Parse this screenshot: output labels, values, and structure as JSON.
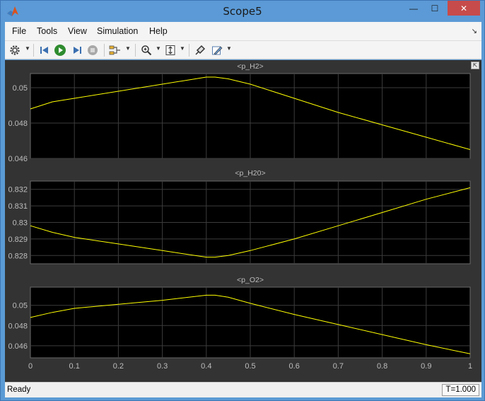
{
  "window": {
    "title": "Scope5",
    "minimize_glyph": "—",
    "maximize_glyph": "☐",
    "close_glyph": "✕"
  },
  "menu": {
    "items": [
      "File",
      "Tools",
      "View",
      "Simulation",
      "Help"
    ],
    "corner_glyph": "↘"
  },
  "toolbar": {
    "icons": [
      "gear-icon",
      "step-back-icon",
      "run-icon",
      "step-forward-icon",
      "stop-icon",
      "signal-selector-icon",
      "zoom-icon",
      "autoscale-icon",
      "highlight-icon",
      "style-icon"
    ]
  },
  "colors": {
    "plot_background": "#000000",
    "trace": "#ffff00",
    "grid": "#3c3c3c",
    "frame_background": "#333333",
    "label": "#bdbdbd"
  },
  "chart_data": [
    {
      "type": "line",
      "title": "<p_H2>",
      "xlim": [
        0,
        1
      ],
      "ylim": [
        0.046,
        0.0508
      ],
      "yticks": [
        0.046,
        0.048,
        0.05
      ],
      "ytick_labels": [
        "0.046",
        "0.048",
        "0.05"
      ],
      "show_xticks": false,
      "grid": true,
      "x": [
        0,
        0.05,
        0.1,
        0.2,
        0.3,
        0.4,
        0.42,
        0.45,
        0.5,
        0.6,
        0.7,
        0.8,
        0.9,
        1.0
      ],
      "y": [
        0.0488,
        0.0492,
        0.0494,
        0.0498,
        0.0502,
        0.0506,
        0.0506,
        0.0505,
        0.0502,
        0.0494,
        0.0486,
        0.0479,
        0.0472,
        0.0465
      ]
    },
    {
      "type": "line",
      "title": "<p_H20>",
      "xlim": [
        0,
        1
      ],
      "ylim": [
        0.8275,
        0.8325
      ],
      "yticks": [
        0.828,
        0.829,
        0.83,
        0.831,
        0.832
      ],
      "ytick_labels": [
        "0.828",
        "0.829",
        "0.83",
        "0.831",
        "0.832"
      ],
      "show_xticks": false,
      "grid": true,
      "x": [
        0,
        0.05,
        0.1,
        0.2,
        0.3,
        0.4,
        0.42,
        0.45,
        0.5,
        0.6,
        0.7,
        0.8,
        0.9,
        1.0
      ],
      "y": [
        0.8298,
        0.8294,
        0.8291,
        0.8287,
        0.8283,
        0.8279,
        0.8279,
        0.828,
        0.8283,
        0.829,
        0.8298,
        0.8306,
        0.8314,
        0.8321
      ]
    },
    {
      "type": "line",
      "title": "<p_O2>",
      "xlim": [
        0,
        1
      ],
      "ylim": [
        0.0448,
        0.0518
      ],
      "yticks": [
        0.046,
        0.048,
        0.05
      ],
      "ytick_labels": [
        "0.046",
        "0.048",
        "0.05"
      ],
      "show_xticks": true,
      "xticks": [
        0,
        0.1,
        0.2,
        0.3,
        0.4,
        0.5,
        0.6,
        0.7,
        0.8,
        0.9,
        1
      ],
      "xtick_labels": [
        "0",
        "0.1",
        "0.2",
        "0.3",
        "0.4",
        "0.5",
        "0.6",
        "0.7",
        "0.8",
        "0.9",
        "1"
      ],
      "grid": true,
      "x": [
        0,
        0.05,
        0.1,
        0.2,
        0.3,
        0.4,
        0.42,
        0.45,
        0.5,
        0.6,
        0.7,
        0.8,
        0.9,
        1.0
      ],
      "y": [
        0.0488,
        0.0493,
        0.0497,
        0.0501,
        0.0505,
        0.051,
        0.051,
        0.0508,
        0.0502,
        0.0491,
        0.0481,
        0.0471,
        0.0461,
        0.0452
      ]
    }
  ],
  "status": {
    "text": "Ready",
    "time": "T=1.000"
  }
}
